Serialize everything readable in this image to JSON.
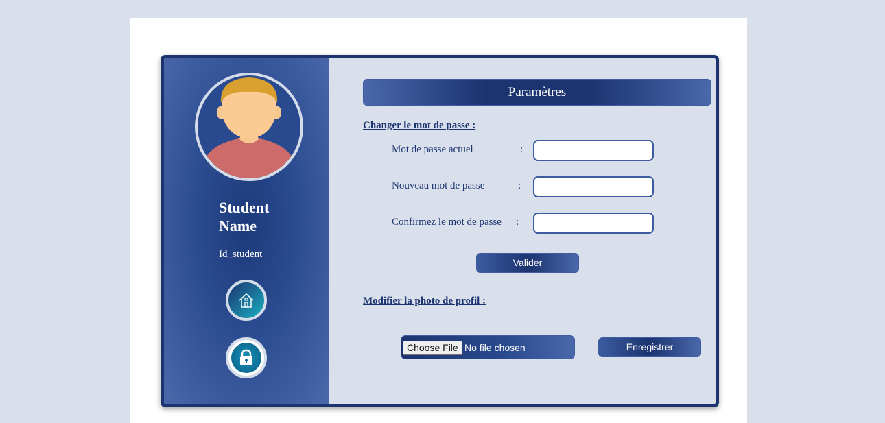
{
  "sidebar": {
    "student_name": "Student Name",
    "student_id": "Id_student",
    "home_icon": "home-icon",
    "lock_icon": "lock-icon"
  },
  "main": {
    "title": "Paramètres",
    "password_section": {
      "heading": "Changer le mot de passe :",
      "fields": [
        {
          "label": "Mot de passe actuel",
          "value": ""
        },
        {
          "label": "Nouveau mot de passe",
          "value": ""
        },
        {
          "label": "Confirmez le mot de passe",
          "value": ""
        }
      ],
      "colon": ":",
      "submit_label": "Valider"
    },
    "photo_section": {
      "heading": "Modifier la photo de profil :",
      "choose_file_label": "Choose File",
      "file_status": "No file chosen",
      "save_label": "Enregistrer"
    }
  },
  "colors": {
    "background": "#d9e0ec",
    "primary": "#1c3470",
    "accent_light": "#4a68aa",
    "teal": "#1ab0c0"
  }
}
